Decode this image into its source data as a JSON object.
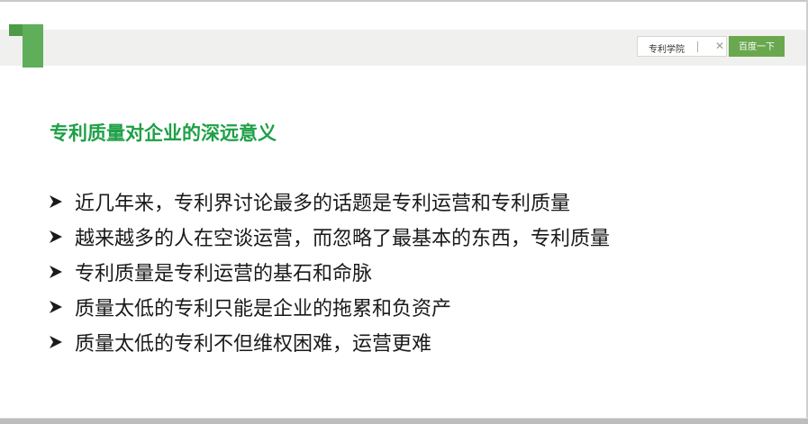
{
  "header": {
    "search": {
      "value": "专利学院",
      "button_label": "百度一下"
    }
  },
  "content": {
    "title": "专利质量对企业的深远意义",
    "bullets": [
      "近几年来，专利界讨论最多的话题是专利运营和专利质量",
      "越来越多的人在空谈运营，而忽略了最基本的东西，专利质量",
      "专利质量是专利运营的基石和命脉",
      "质量太低的专利只能是企业的拖累和负资产",
      "质量太低的专利不但维权困难，运营更难"
    ]
  },
  "colors": {
    "accent_green": "#1ea046",
    "button_green": "#6aa84f",
    "logo_green": "#5fae5a"
  },
  "icons": {
    "logo": "green-number-one-logo",
    "clear": "close-icon",
    "bullet": "arrow-right-icon"
  }
}
